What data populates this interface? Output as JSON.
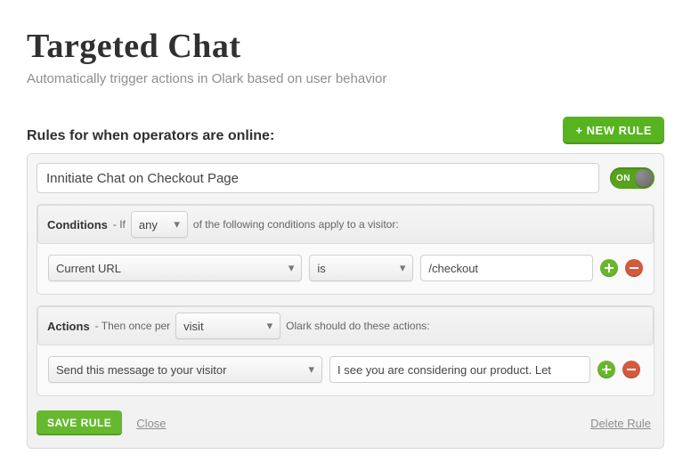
{
  "header": {
    "title": "Targeted Chat",
    "subtitle": "Automatically trigger actions in Olark based on user behavior"
  },
  "rules_section": {
    "title": "Rules for when operators are online:",
    "new_rule_label": "+ NEW RULE"
  },
  "rule": {
    "name": "Innitiate Chat on Checkout Page",
    "toggle_label": "ON",
    "conditions": {
      "heading": "Conditions",
      "prefix": "- If",
      "mode": "any",
      "suffix": "of the following conditions apply to a visitor:",
      "items": [
        {
          "field": "Current URL",
          "operator": "is",
          "value": "/checkout"
        }
      ]
    },
    "actions": {
      "heading": "Actions",
      "prefix": "- Then once per",
      "scope": "visit",
      "suffix": "Olark should do these actions:",
      "items": [
        {
          "action": "Send this message to your visitor",
          "value": "I see you are considering our product. Let"
        }
      ]
    },
    "footer": {
      "save": "SAVE RULE",
      "close": "Close",
      "delete": "Delete Rule"
    }
  }
}
